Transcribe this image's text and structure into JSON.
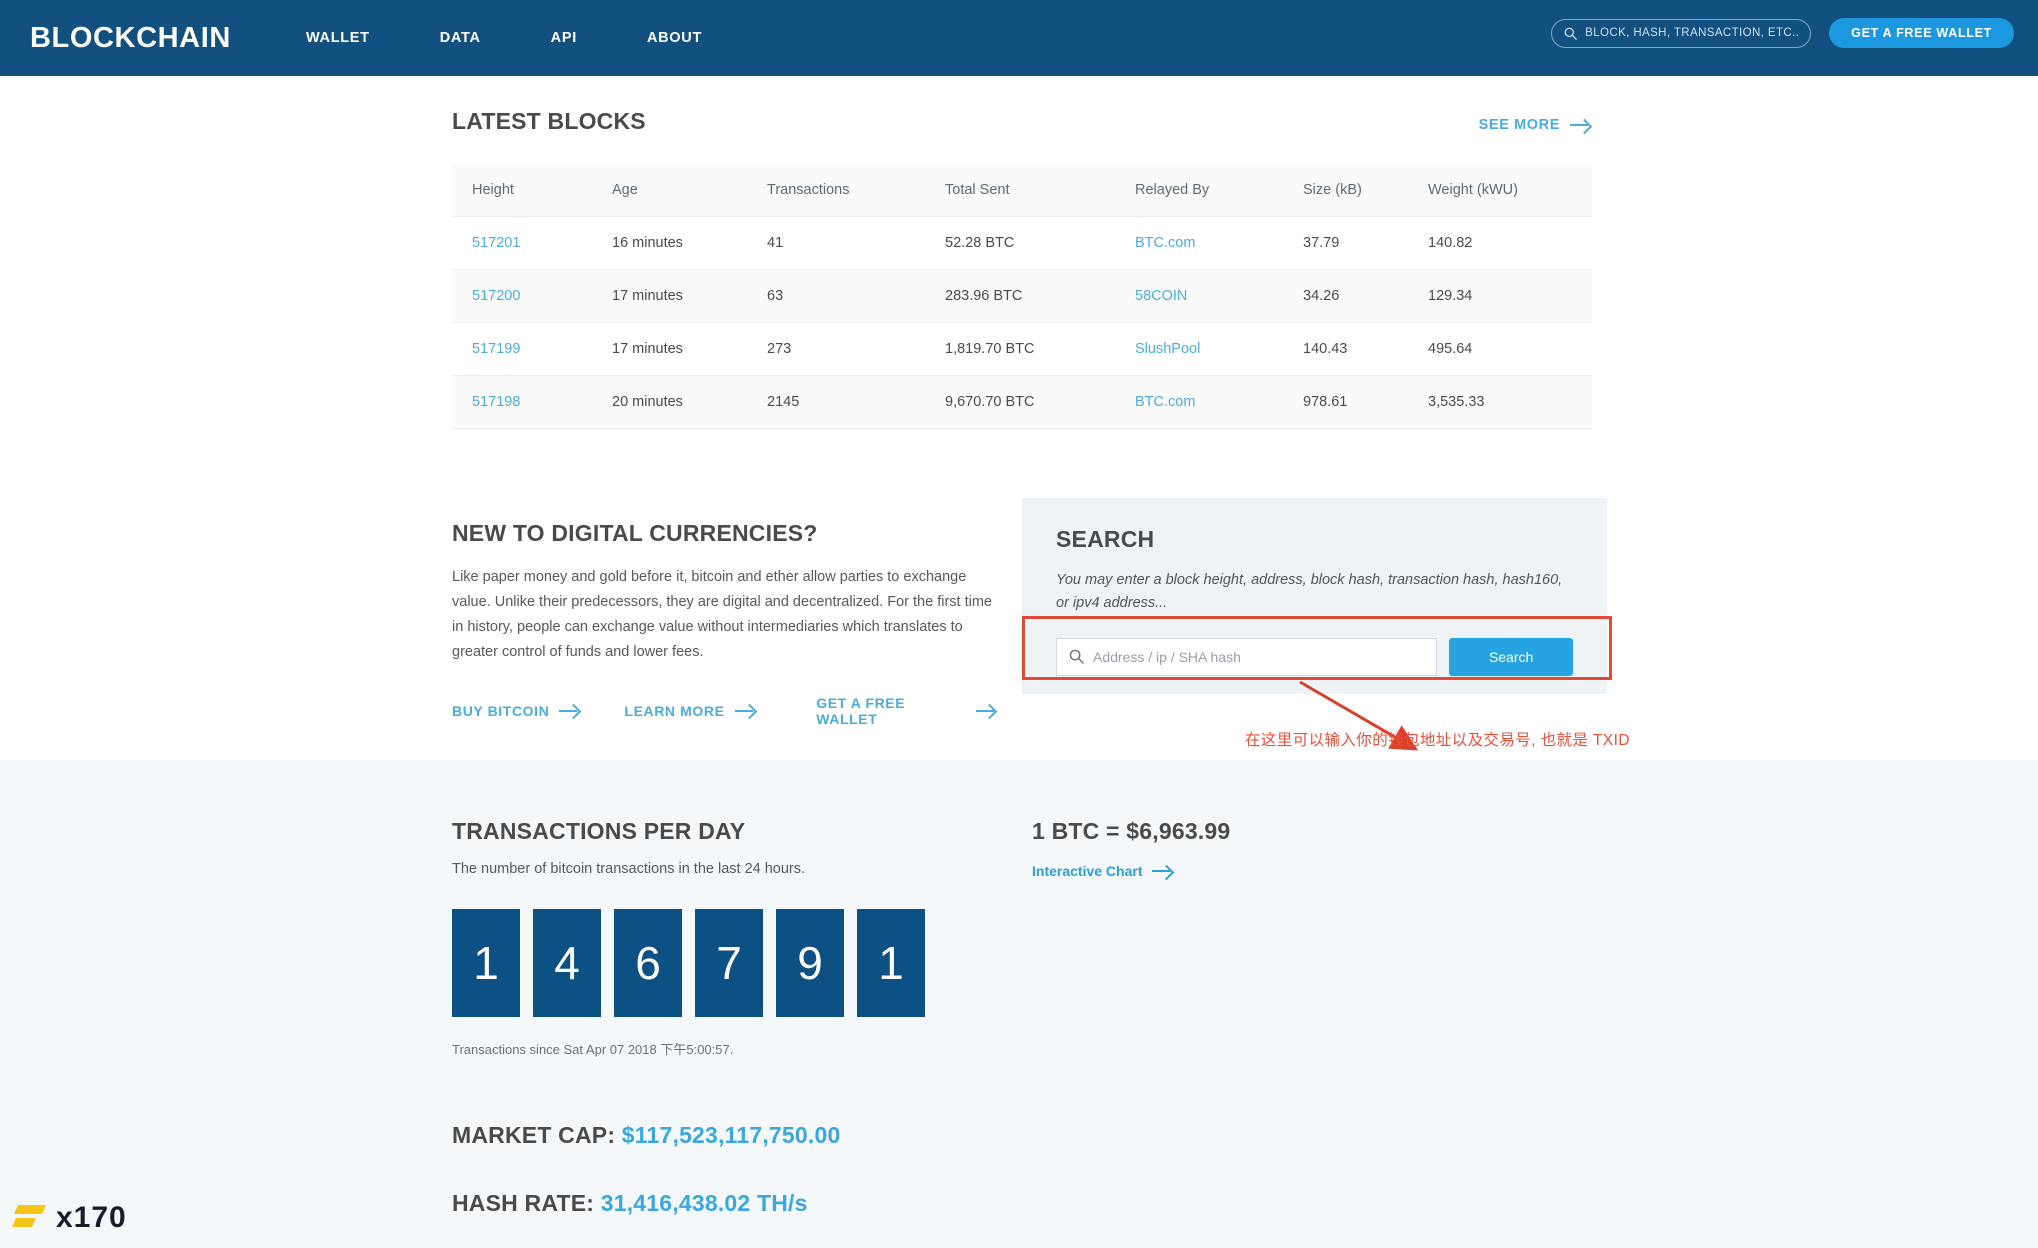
{
  "header": {
    "brand": "BLOCKCHAIN",
    "nav": [
      {
        "label": "WALLET"
      },
      {
        "label": "DATA"
      },
      {
        "label": "API"
      },
      {
        "label": "ABOUT"
      }
    ],
    "search_placeholder": "BLOCK, HASH, TRANSACTION, ETC...",
    "cta_label": "GET A FREE WALLET",
    "bg_color": "#11507f",
    "cta_color": "#1b98e0"
  },
  "latest_blocks": {
    "title": "LATEST BLOCKS",
    "see_more": "SEE MORE",
    "columns": [
      "Height",
      "Age",
      "Transactions",
      "Total Sent",
      "Relayed By",
      "Size (kB)",
      "Weight (kWU)"
    ],
    "rows": [
      {
        "height": "517201",
        "age": "16 minutes",
        "transactions": "41",
        "total_sent": "52.28 BTC",
        "relayed_by": "BTC.com",
        "size": "37.79",
        "weight": "140.82"
      },
      {
        "height": "517200",
        "age": "17 minutes",
        "transactions": "63",
        "total_sent": "283.96 BTC",
        "relayed_by": "58COIN",
        "size": "34.26",
        "weight": "129.34"
      },
      {
        "height": "517199",
        "age": "17 minutes",
        "transactions": "273",
        "total_sent": "1,819.70 BTC",
        "relayed_by": "SlushPool",
        "size": "140.43",
        "weight": "495.64"
      },
      {
        "height": "517198",
        "age": "20 minutes",
        "transactions": "2145",
        "total_sent": "9,670.70 BTC",
        "relayed_by": "BTC.com",
        "size": "978.61",
        "weight": "3,535.33"
      }
    ]
  },
  "new_to_digital": {
    "title": "NEW TO DIGITAL CURRENCIES?",
    "body": "Like paper money and gold before it, bitcoin and ether allow parties to exchange value. Unlike their predecessors, they are digital and decentralized. For the first time in history, people can exchange value without intermediaries which translates to greater control of funds and lower fees.",
    "links": [
      {
        "label": "BUY BITCOIN"
      },
      {
        "label": "LEARN MORE"
      },
      {
        "label": "GET A FREE WALLET"
      }
    ]
  },
  "search_panel": {
    "title": "SEARCH",
    "hint": "You may enter a block height, address, block hash, transaction hash, hash160, or ipv4 address...",
    "input_placeholder": "Address / ip / SHA hash",
    "button_label": "Search",
    "button_color": "#25a4e1",
    "panel_bg": "#eef3f8"
  },
  "annotation": {
    "text": "在这里可以输入你的钱包地址以及交易号, 也就是 TXID",
    "color": "#e8503a"
  },
  "transactions_per_day": {
    "title": "TRANSACTIONS PER DAY",
    "subtitle": "The number of bitcoin transactions in the last 24 hours.",
    "digits": [
      "1",
      "4",
      "6",
      "7",
      "9",
      "1"
    ],
    "since": "Transactions since Sat Apr 07 2018 下午5:00:57.",
    "tile_color": "#0d5084"
  },
  "price": {
    "line": "1 BTC = $6,963.99",
    "chart_link": "Interactive Chart"
  },
  "stats": {
    "market_cap_label": "MARKET CAP: ",
    "market_cap_value": "$117,523,117,750.00",
    "hash_rate_label": "HASH RATE: ",
    "hash_rate_value": "31,416,438.02 TH/s",
    "value_color": "#3aa7dd"
  },
  "watermark": {
    "text": "x170"
  }
}
